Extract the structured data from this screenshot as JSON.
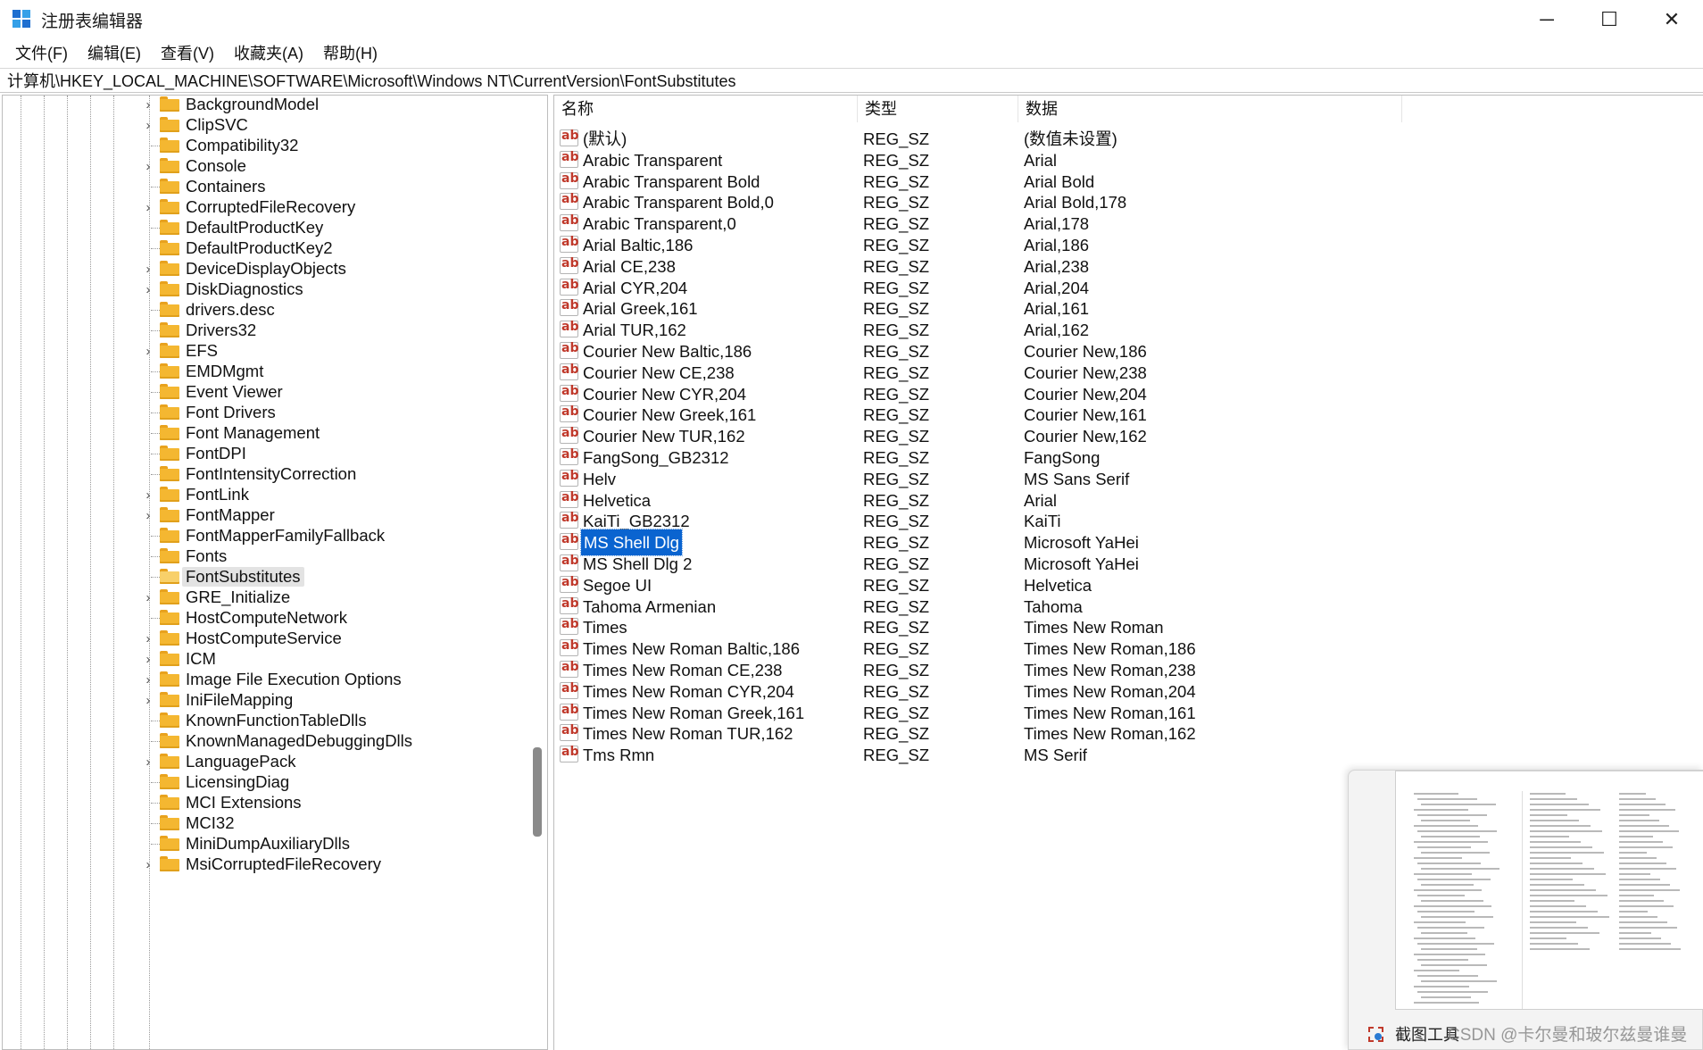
{
  "window": {
    "title": "注册表编辑器",
    "minimize_glyph": "─",
    "maximize_glyph": "☐",
    "close_glyph": "✕"
  },
  "menu": [
    "文件(F)",
    "编辑(E)",
    "查看(V)",
    "收藏夹(A)",
    "帮助(H)"
  ],
  "address": "计算机\\HKEY_LOCAL_MACHINE\\SOFTWARE\\Microsoft\\Windows NT\\CurrentVersion\\FontSubstitutes",
  "tree": {
    "expander_glyph": "›",
    "items": [
      {
        "label": "BackgroundModel",
        "expandable": true
      },
      {
        "label": "ClipSVC",
        "expandable": true
      },
      {
        "label": "Compatibility32",
        "expandable": false
      },
      {
        "label": "Console",
        "expandable": true
      },
      {
        "label": "Containers",
        "expandable": false
      },
      {
        "label": "CorruptedFileRecovery",
        "expandable": true
      },
      {
        "label": "DefaultProductKey",
        "expandable": false
      },
      {
        "label": "DefaultProductKey2",
        "expandable": false
      },
      {
        "label": "DeviceDisplayObjects",
        "expandable": true
      },
      {
        "label": "DiskDiagnostics",
        "expandable": true
      },
      {
        "label": "drivers.desc",
        "expandable": false
      },
      {
        "label": "Drivers32",
        "expandable": false
      },
      {
        "label": "EFS",
        "expandable": true
      },
      {
        "label": "EMDMgmt",
        "expandable": false
      },
      {
        "label": "Event Viewer",
        "expandable": false
      },
      {
        "label": "Font Drivers",
        "expandable": false
      },
      {
        "label": "Font Management",
        "expandable": false
      },
      {
        "label": "FontDPI",
        "expandable": false
      },
      {
        "label": "FontIntensityCorrection",
        "expandable": false
      },
      {
        "label": "FontLink",
        "expandable": true
      },
      {
        "label": "FontMapper",
        "expandable": true
      },
      {
        "label": "FontMapperFamilyFallback",
        "expandable": false
      },
      {
        "label": "Fonts",
        "expandable": false
      },
      {
        "label": "FontSubstitutes",
        "expandable": false,
        "selected": true
      },
      {
        "label": "GRE_Initialize",
        "expandable": true
      },
      {
        "label": "HostComputeNetwork",
        "expandable": false
      },
      {
        "label": "HostComputeService",
        "expandable": true
      },
      {
        "label": "ICM",
        "expandable": true
      },
      {
        "label": "Image File Execution Options",
        "expandable": true
      },
      {
        "label": "IniFileMapping",
        "expandable": true
      },
      {
        "label": "KnownFunctionTableDlls",
        "expandable": false
      },
      {
        "label": "KnownManagedDebuggingDlls",
        "expandable": false
      },
      {
        "label": "LanguagePack",
        "expandable": true
      },
      {
        "label": "LicensingDiag",
        "expandable": false
      },
      {
        "label": "MCI Extensions",
        "expandable": false
      },
      {
        "label": "MCI32",
        "expandable": false
      },
      {
        "label": "MiniDumpAuxiliaryDlls",
        "expandable": false
      },
      {
        "label": "MsiCorruptedFileRecovery",
        "expandable": true
      }
    ]
  },
  "list": {
    "columns": [
      "名称",
      "类型",
      "数据"
    ],
    "rows": [
      {
        "name": "(默认)",
        "type": "REG_SZ",
        "data": "(数值未设置)"
      },
      {
        "name": "Arabic Transparent",
        "type": "REG_SZ",
        "data": "Arial"
      },
      {
        "name": "Arabic Transparent Bold",
        "type": "REG_SZ",
        "data": "Arial Bold"
      },
      {
        "name": "Arabic Transparent Bold,0",
        "type": "REG_SZ",
        "data": "Arial Bold,178"
      },
      {
        "name": "Arabic Transparent,0",
        "type": "REG_SZ",
        "data": "Arial,178"
      },
      {
        "name": "Arial Baltic,186",
        "type": "REG_SZ",
        "data": "Arial,186"
      },
      {
        "name": "Arial CE,238",
        "type": "REG_SZ",
        "data": "Arial,238"
      },
      {
        "name": "Arial CYR,204",
        "type": "REG_SZ",
        "data": "Arial,204"
      },
      {
        "name": "Arial Greek,161",
        "type": "REG_SZ",
        "data": "Arial,161"
      },
      {
        "name": "Arial TUR,162",
        "type": "REG_SZ",
        "data": "Arial,162"
      },
      {
        "name": "Courier New Baltic,186",
        "type": "REG_SZ",
        "data": "Courier New,186"
      },
      {
        "name": "Courier New CE,238",
        "type": "REG_SZ",
        "data": "Courier New,238"
      },
      {
        "name": "Courier New CYR,204",
        "type": "REG_SZ",
        "data": "Courier New,204"
      },
      {
        "name": "Courier New Greek,161",
        "type": "REG_SZ",
        "data": "Courier New,161"
      },
      {
        "name": "Courier New TUR,162",
        "type": "REG_SZ",
        "data": "Courier New,162"
      },
      {
        "name": "FangSong_GB2312",
        "type": "REG_SZ",
        "data": "FangSong"
      },
      {
        "name": "Helv",
        "type": "REG_SZ",
        "data": "MS Sans Serif"
      },
      {
        "name": "Helvetica",
        "type": "REG_SZ",
        "data": "Arial"
      },
      {
        "name": "KaiTi_GB2312",
        "type": "REG_SZ",
        "data": "KaiTi"
      },
      {
        "name": "MS Shell Dlg",
        "type": "REG_SZ",
        "data": "Microsoft YaHei",
        "selected": true
      },
      {
        "name": "MS Shell Dlg 2",
        "type": "REG_SZ",
        "data": "Microsoft YaHei"
      },
      {
        "name": "Segoe UI",
        "type": "REG_SZ",
        "data": "Helvetica"
      },
      {
        "name": "Tahoma Armenian",
        "type": "REG_SZ",
        "data": "Tahoma"
      },
      {
        "name": "Times",
        "type": "REG_SZ",
        "data": "Times New Roman"
      },
      {
        "name": "Times New Roman Baltic,186",
        "type": "REG_SZ",
        "data": "Times New Roman,186"
      },
      {
        "name": "Times New Roman CE,238",
        "type": "REG_SZ",
        "data": "Times New Roman,238"
      },
      {
        "name": "Times New Roman CYR,204",
        "type": "REG_SZ",
        "data": "Times New Roman,204"
      },
      {
        "name": "Times New Roman Greek,161",
        "type": "REG_SZ",
        "data": "Times New Roman,161"
      },
      {
        "name": "Times New Roman TUR,162",
        "type": "REG_SZ",
        "data": "Times New Roman,162"
      },
      {
        "name": "Tms Rmn",
        "type": "REG_SZ",
        "data": "MS Serif"
      }
    ]
  },
  "snip_popup": {
    "title": "截图工具"
  },
  "watermark": "CSDN @卡尔曼和玻尔兹曼谁曼",
  "colors": {
    "selection": "#0a64d0",
    "folder": "#f4b731",
    "value_icon": "#c0392b"
  }
}
